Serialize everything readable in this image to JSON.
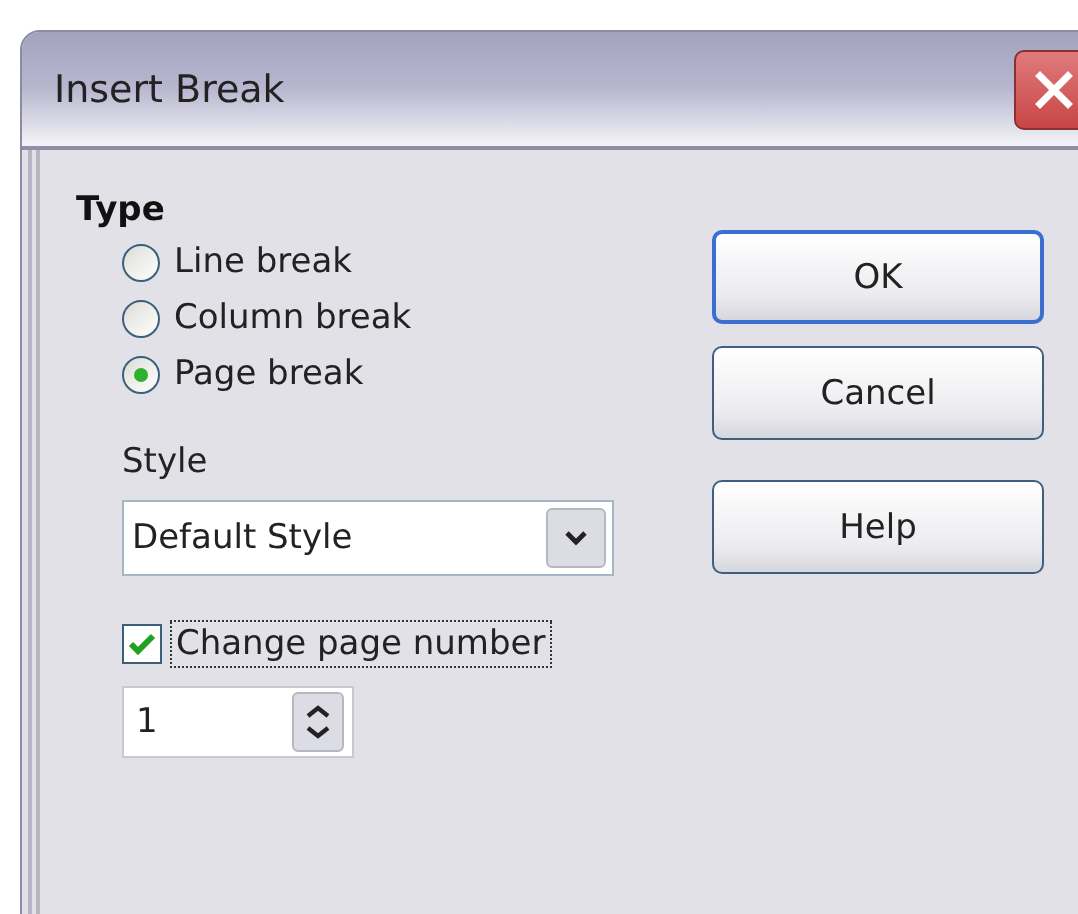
{
  "window": {
    "title": "Insert Break"
  },
  "type": {
    "label": "Type",
    "options": [
      {
        "label": "Line break",
        "selected": false
      },
      {
        "label": "Column break",
        "selected": false
      },
      {
        "label": "Page break",
        "selected": true
      }
    ]
  },
  "style": {
    "label": "Style",
    "value": "Default Style"
  },
  "change_page_number": {
    "label": "Change page number",
    "checked": true,
    "focused": true
  },
  "page_number": {
    "value": "1"
  },
  "buttons": [
    {
      "label": "OK",
      "default": true
    },
    {
      "label": "Cancel",
      "default": false
    },
    {
      "label": "Help",
      "default": false
    }
  ]
}
